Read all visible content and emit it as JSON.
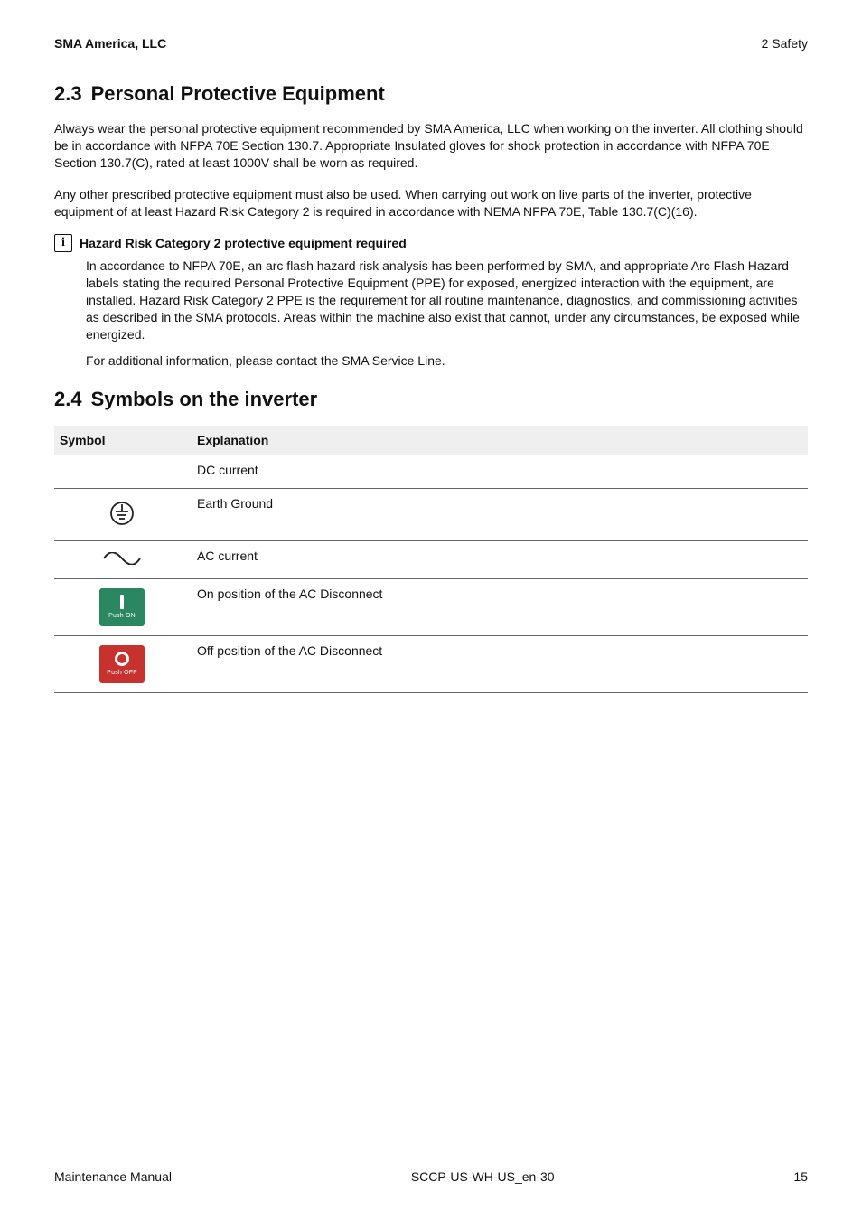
{
  "header": {
    "company": "SMA America, LLC",
    "section_ref": "2  Safety"
  },
  "s23": {
    "num": "2.3",
    "title": "Personal Protective Equipment",
    "p1": "Always wear the personal protective equipment recommended by SMA America, LLC when working on the inverter. All clothing should be in accordance with NFPA 70E Section 130.7. Appropriate Insulated gloves for shock protection in accordance with NFPA 70E Section 130.7(C), rated at least 1000V shall be worn as required.",
    "p2": "Any other prescribed protective equipment must also be used. When carrying out work on live parts of the inverter, protective equipment of at least Hazard Risk Category 2 is required in accordance with NEMA NFPA 70E, Table 130.7(C)(16).",
    "info_title": "Hazard Risk Category 2 protective equipment required",
    "info_p1": "In accordance to NFPA 70E, an arc flash hazard risk analysis has been performed by SMA, and appropriate Arc Flash Hazard labels stating the required Personal Protective Equipment (PPE) for exposed, energized interaction with the equipment, are installed. Hazard Risk Category 2 PPE is the requirement for all routine maintenance, diagnostics, and commissioning activities as described in the SMA protocols. Areas within the machine also exist that cannot, under any circumstances, be exposed while energized.",
    "info_p2": "For additional information, please contact the SMA Service Line."
  },
  "s24": {
    "num": "2.4",
    "title": "Symbols on the inverter",
    "th_symbol": "Symbol",
    "th_expl": "Explanation",
    "rows": [
      {
        "icon": "dc",
        "expl": "DC current"
      },
      {
        "icon": "earth_ground",
        "expl": "Earth Ground"
      },
      {
        "icon": "ac",
        "expl": "AC current"
      },
      {
        "icon": "push_on",
        "label": "Push ON",
        "expl": "On position of the AC Disconnect"
      },
      {
        "icon": "push_off",
        "label": "Push OFF",
        "expl": "Off position of the AC Disconnect"
      }
    ]
  },
  "footer": {
    "left": "Maintenance Manual",
    "center": "SCCP-US-WH-US_en-30",
    "right": "15"
  }
}
